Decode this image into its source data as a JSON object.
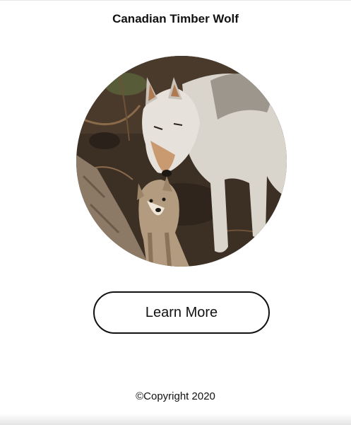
{
  "header": {
    "title": "Canadian Timber Wolf"
  },
  "hero_image": {
    "subject": "timber-wolf-with-pup"
  },
  "cta": {
    "label": "Learn More"
  },
  "footer": {
    "copyright": "©Copyright 2020"
  },
  "colors": {
    "text": "#111111",
    "button_border": "#111111",
    "background": "#ffffff"
  }
}
